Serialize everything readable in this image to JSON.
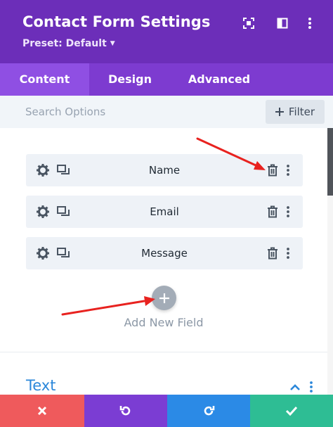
{
  "header": {
    "title": "Contact Form Settings",
    "preset": "Preset: Default",
    "icons": [
      "focus-icon",
      "split-view-icon",
      "more-vertical-icon"
    ]
  },
  "tabs": [
    {
      "label": "Content",
      "active": true
    },
    {
      "label": "Design",
      "active": false
    },
    {
      "label": "Advanced",
      "active": false
    }
  ],
  "search": {
    "placeholder": "Search Options",
    "filter_label": "Filter"
  },
  "fields": [
    {
      "label": "Name"
    },
    {
      "label": "Email"
    },
    {
      "label": "Message"
    }
  ],
  "add_field_label": "Add New Field",
  "section": {
    "title": "Text"
  },
  "footer": {
    "buttons": [
      "close",
      "undo",
      "redo",
      "save"
    ]
  },
  "colors": {
    "header_bg": "#6c2eb9",
    "tabs_bg": "#7d3bd0",
    "active_tab_bg": "#8f4fe3",
    "section_title": "#2b87da",
    "footer_close": "#ef5a5c",
    "footer_undo": "#7b3dd3",
    "footer_redo": "#2b8ae6",
    "footer_save": "#2ebd94",
    "annotation_arrow": "#e8221f"
  }
}
